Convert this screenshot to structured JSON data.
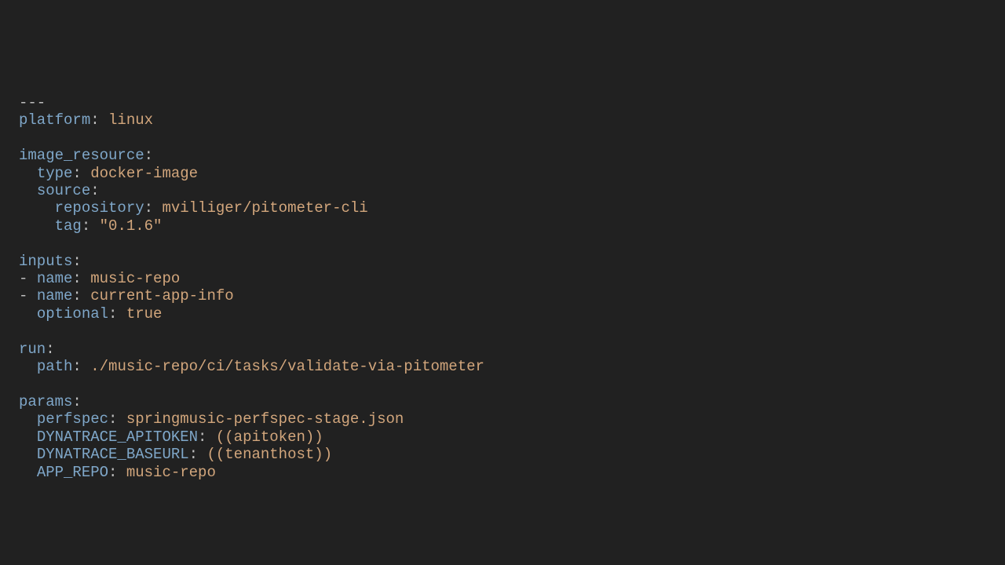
{
  "yaml": {
    "doc_start": "---",
    "platform_key": "platform",
    "platform_val": "linux",
    "image_resource_key": "image_resource",
    "type_key": "type",
    "type_val": "docker-image",
    "source_key": "source",
    "repository_key": "repository",
    "repository_val": "mvilliger/pitometer-cli",
    "tag_key": "tag",
    "tag_val": "\"0.1.6\"",
    "inputs_key": "inputs",
    "name_key": "name",
    "input1_val": "music-repo",
    "input2_val": "current-app-info",
    "optional_key": "optional",
    "optional_val": "true",
    "run_key": "run",
    "path_key": "path",
    "path_val": "./music-repo/ci/tasks/validate-via-pitometer",
    "params_key": "params",
    "perfspec_key": "perfspec",
    "perfspec_val": "springmusic-perfspec-stage.json",
    "dt_token_key": "DYNATRACE_APITOKEN",
    "dt_token_val": "((apitoken))",
    "dt_url_key": "DYNATRACE_BASEURL",
    "dt_url_val": "((tenanthost))",
    "app_repo_key": "APP_REPO",
    "app_repo_val": "music-repo"
  }
}
